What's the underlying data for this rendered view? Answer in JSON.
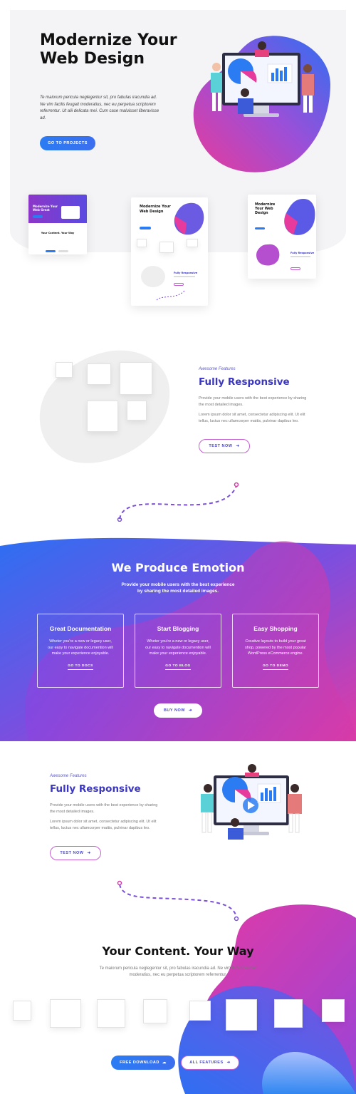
{
  "hero": {
    "title": "Modernize Your Web Design",
    "text": "Te maiorum pericula neglegentur sit, pro fabulas iracundia ad. Ne vim facilis feugait moderatius, nec eu perpetua scriptorem referrentur. Ut alii delicata mei. Cum case maluisset liberavisse ad.",
    "button": "GO TO PROJECTS"
  },
  "mockups": {
    "left_title": "Modernize Your Web Great",
    "left_sub": "Your Content. Your Way",
    "center_title": "Modernize Your Web Design",
    "center_feature": "Fully Responsive",
    "right_title": "Modernize Your Web Design",
    "right_feature": "Fully Responsive"
  },
  "feature1": {
    "eyebrow": "Awesome Features",
    "title": "Fully Responsive",
    "text1": "Provide your mobile users with the best experience by sharing the most detailed images.",
    "text2": "Lorem ipsum dolor sit amet, consectetur adipiscing elit. Ut elit tellus, luctus nec ullamcorper mattis, pulvinar dapibus leo.",
    "button": "TEST NOW"
  },
  "band": {
    "title": "We Produce Emotion",
    "subtitle": "Provide your mobile users with the best experience by sharing the most detailed images.",
    "cards": [
      {
        "title": "Great Documentation",
        "text": "Wheter you're a new or legacy user, our easy to navigate documention will make your experience enjoyable.",
        "link": "GO TO DOCS"
      },
      {
        "title": "Start Blogging",
        "text": "Wheter you're a new or legacy user, our easy to navigate documention will make your experience enjoyable.",
        "link": "GO TO BLOG"
      },
      {
        "title": "Easy Shopping",
        "text": "Creative layouts to build your great shop, powered by the most popular WordPress eCommerce engine.",
        "link": "GO TO DEMO"
      }
    ],
    "button": "BUY NOW"
  },
  "feature2": {
    "eyebrow": "Awesome Features",
    "title": "Fully Responsive",
    "text1": "Provide your mobile users with the best experience by sharing the most detailed images.",
    "text2": "Lorem ipsum dolor sit amet, consectetur adipiscing elit. Ut elit tellus, luctus nec ullamcorper mattis, pulvinar dapibus leo.",
    "button": "TEST NOW"
  },
  "content": {
    "title": "Your Content. Your Way",
    "text": "Te maiorum pericula neglegentur sit, pro fabulas iracundia ad. Ne vim facilis feugait moderatius, nec eu perpetua scriptorem referrentur.",
    "btn_download": "FREE DOWNLOAD",
    "btn_features": "ALL FEATURES"
  },
  "colors": {
    "blue": "#2b7cf2",
    "purple": "#3b37c0",
    "pink": "#d63aa8"
  },
  "icons": [
    "arrow-right-icon",
    "cloud-download-icon",
    "play-icon"
  ]
}
